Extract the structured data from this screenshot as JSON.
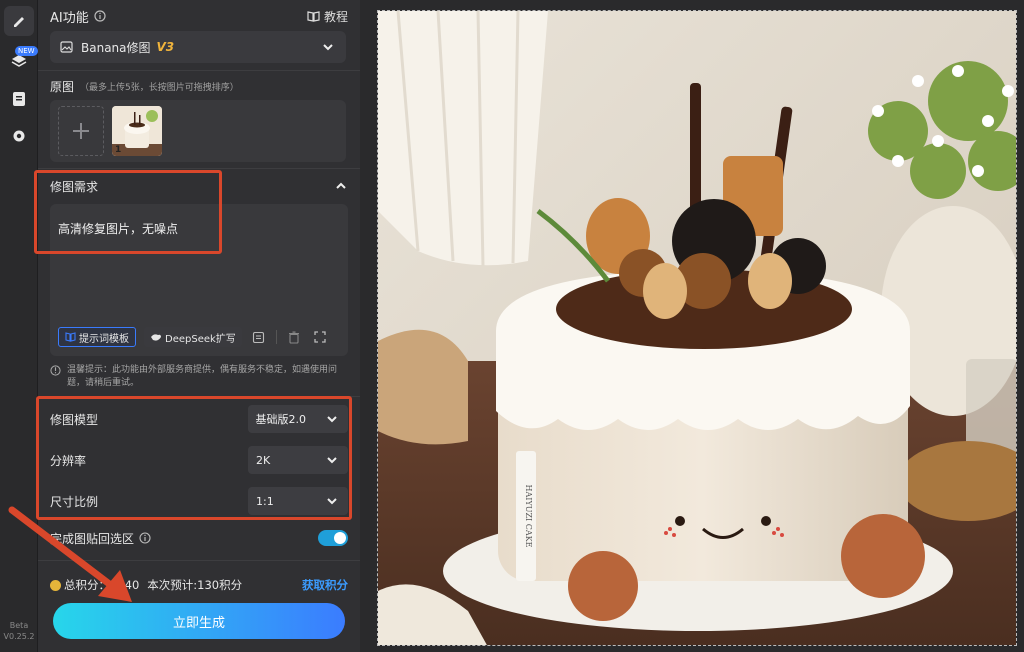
{
  "rail": {
    "new_badge": "NEW",
    "version_line1": "Beta",
    "version_line2": "V0.25.2"
  },
  "panel": {
    "ai_title": "AI功能",
    "tutorial_label": "教程",
    "model": {
      "name": "Banana修图",
      "version": "V3"
    },
    "original": {
      "title": "原图",
      "hint": "（最多上传5张，长按图片可拖拽排序）",
      "thumb_index": "1"
    },
    "requirement": {
      "title": "修图需求",
      "text": "高清修复图片，无噪点",
      "template_button": "提示词模板",
      "deepseek_button": "DeepSeek扩写"
    },
    "tip": "温馨提示：此功能由外部服务商提供，偶有服务不稳定，如遇使用问题，请稍后重试。",
    "settings": [
      {
        "label": "修图模型",
        "value": "基础版2.0"
      },
      {
        "label": "分辨率",
        "value": "2K"
      },
      {
        "label": "尺寸比例",
        "value": "1:1"
      }
    ],
    "paste_back": {
      "label": "完成图贴回选区",
      "enabled": true
    },
    "points": {
      "total_label": "总积分：",
      "total_value": "1640",
      "estimate_label": "本次预计:130积分",
      "get_link": "获取积分"
    },
    "generate_button": "立即生成"
  },
  "photo": {
    "label": "HAIYUZI CAKE"
  },
  "colors": {
    "accent": "#3b7cff",
    "highlight": "#d9472b",
    "toggle": "#1f9fd9"
  }
}
